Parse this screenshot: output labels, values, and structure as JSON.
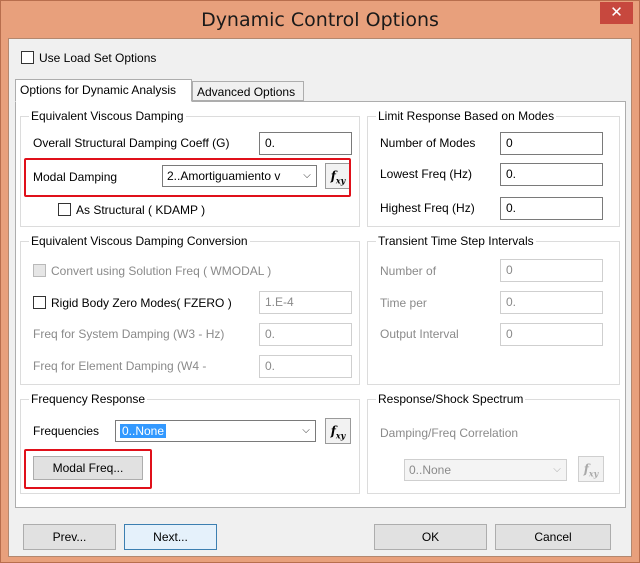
{
  "window": {
    "title": "Dynamic Control Options",
    "close_glyph": "✕"
  },
  "top": {
    "use_load_set_label": "Use Load Set Options",
    "use_load_set_checked": false
  },
  "tabs": [
    {
      "label": "Options for Dynamic Analysis",
      "active": true
    },
    {
      "label": "Advanced Options",
      "active": false
    }
  ],
  "equivalent_viscous_damping": {
    "title": "Equivalent Viscous Damping",
    "overall_label": "Overall Structural Damping Coeff (G)",
    "overall_value": "0.",
    "modal_label": "Modal Damping",
    "modal_value": "2..Amortiguamiento v",
    "as_structural_label": "As Structural ( KDAMP )",
    "as_structural_checked": false
  },
  "limit_response": {
    "title": "Limit Response Based on Modes",
    "num_modes_label": "Number of Modes",
    "num_modes_value": "0",
    "lowest_freq_label": "Lowest Freq (Hz)",
    "lowest_freq_value": "0.",
    "highest_freq_label": "Highest Freq (Hz)",
    "highest_freq_value": "0."
  },
  "damping_conversion": {
    "title": "Equivalent Viscous Damping Conversion",
    "convert_label": "Convert using Solution Freq ( WMODAL )",
    "rigid_body_label": "Rigid Body Zero Modes( FZERO )",
    "rigid_body_value": "1.E-4",
    "freq_system_label": "Freq for System Damping (W3 - Hz)",
    "freq_system_value": "0.",
    "freq_element_label": "Freq for Element Damping (W4 -",
    "freq_element_value": "0."
  },
  "transient": {
    "title": "Transient Time Step Intervals",
    "number_of_label": "Number of",
    "number_of_value": "0",
    "time_per_label": "Time per",
    "time_per_value": "0.",
    "output_interval_label": "Output Interval",
    "output_interval_value": "0"
  },
  "frequency_response": {
    "title": "Frequency Response",
    "frequencies_label": "Frequencies",
    "frequencies_value": "0..None",
    "modal_freq_button": "Modal Freq..."
  },
  "response_shock": {
    "title": "Response/Shock Spectrum",
    "correlation_label": "Damping/Freq Correlation",
    "correlation_value": "0..None"
  },
  "fxy_icon": {
    "f": "f",
    "xy": "xy"
  },
  "buttons": {
    "prev": "Prev...",
    "next": "Next...",
    "ok": "OK",
    "cancel": "Cancel"
  },
  "colors": {
    "title_bar": "#e8a07c",
    "close_button": "#c7483e",
    "highlight_box": "#e0101a",
    "selection": "#3399ff"
  }
}
